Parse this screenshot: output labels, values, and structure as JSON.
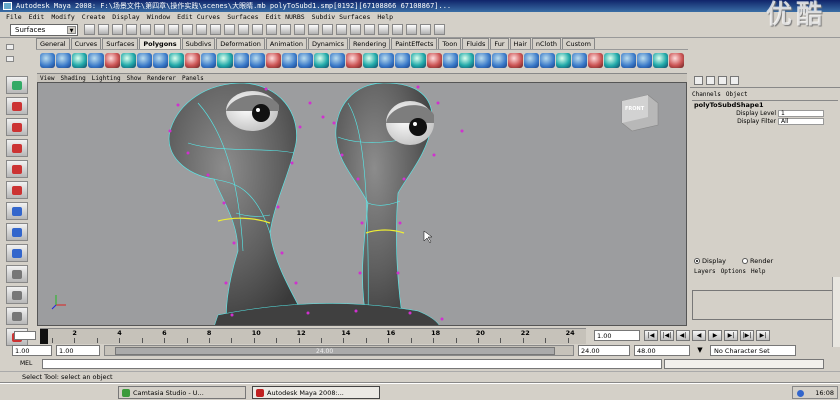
{
  "window": {
    "title": "Autodesk Maya 2008: F:\\场景文件\\第四章\\操作实践\\scenes\\大眼睛.mb      polyToSubd1.smp[0192][67108866 67108867]..."
  },
  "watermark": "优酷",
  "menubar": [
    "File",
    "Edit",
    "Modify",
    "Create",
    "Display",
    "Window",
    "Edit Curves",
    "Surfaces",
    "Edit NURBS",
    "Subdiv Surfaces",
    "Help"
  ],
  "mode_selector": {
    "value": "Surfaces"
  },
  "shelf_tabs": [
    {
      "label": "General",
      "active": false
    },
    {
      "label": "Curves",
      "active": false
    },
    {
      "label": "Surfaces",
      "active": false
    },
    {
      "label": "Polygons",
      "active": true
    },
    {
      "label": "Subdivs",
      "active": false
    },
    {
      "label": "Deformation",
      "active": false
    },
    {
      "label": "Animation",
      "active": false
    },
    {
      "label": "Dynamics",
      "active": false
    },
    {
      "label": "Rendering",
      "active": false
    },
    {
      "label": "PaintEffects",
      "active": false
    },
    {
      "label": "Toon",
      "active": false
    },
    {
      "label": "Fluids",
      "active": false
    },
    {
      "label": "Fur",
      "active": false
    },
    {
      "label": "Hair",
      "active": false
    },
    {
      "label": "nCloth",
      "active": false
    },
    {
      "label": "Custom",
      "active": false
    }
  ],
  "panel_menu": [
    "View",
    "Shading",
    "Lighting",
    "Show",
    "Renderer",
    "Panels"
  ],
  "viewport": {
    "view_cube_label": "FRONT"
  },
  "channel_box": {
    "menu": [
      "Channels",
      "Object"
    ],
    "node": "polyToSubdShape1",
    "attrs": [
      {
        "label": "Display Level",
        "value": "1"
      },
      {
        "label": "Display Filter",
        "value": "All"
      }
    ]
  },
  "layer_editor": {
    "display_label": "Display",
    "render_label": "Render",
    "menu": [
      "Layers",
      "Options",
      "Help"
    ]
  },
  "time_slider": {
    "labels": [
      "2",
      "4",
      "6",
      "8",
      "10",
      "12",
      "14",
      "16",
      "18",
      "20",
      "22",
      "24"
    ],
    "current_frame": "1.00"
  },
  "playback_buttons": [
    "|◀",
    "|◀|",
    "◀|",
    "◀",
    "▶",
    "▶|",
    "|▶|",
    "▶|"
  ],
  "range_slider": {
    "start": "1.00",
    "playback_start": "1.00",
    "end_label": "24.00",
    "playback_end": "24.00",
    "anim_end": "48.00",
    "character_set": "No Character Set"
  },
  "command_line": {
    "label": "MEL"
  },
  "help_line": "Select Tool: select an object",
  "taskbar": {
    "tasks": [
      {
        "label": "Camtasia Studio - U...",
        "color": "#3a9a3a",
        "active": false
      },
      {
        "label": "Autodesk Maya 2008:...",
        "color": "#c02020",
        "active": true
      }
    ],
    "clock": "16:08"
  }
}
